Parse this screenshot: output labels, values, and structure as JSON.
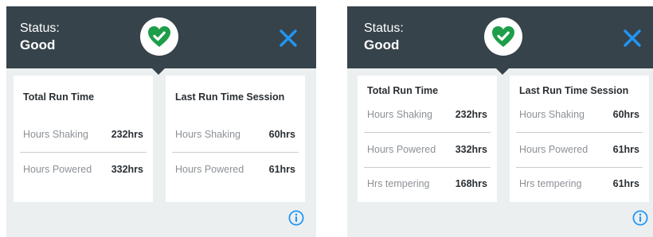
{
  "colors": {
    "header_bg": "#36434b",
    "accent_green": "#1e9e4a",
    "accent_blue": "#2196f3"
  },
  "panels": [
    {
      "status_label": "Status:",
      "status_value": "Good",
      "icons": {
        "status": "heart-check-icon",
        "close": "close-icon",
        "info": "info-icon"
      },
      "cards": [
        {
          "title": "Total Run Time",
          "rows": [
            {
              "label": "Hours Shaking",
              "value": "232hrs"
            },
            {
              "label": "Hours Powered",
              "value": "332hrs"
            }
          ]
        },
        {
          "title": "Last Run Time Session",
          "rows": [
            {
              "label": "Hours Shaking",
              "value": "60hrs"
            },
            {
              "label": "Hours Powered",
              "value": "61hrs"
            }
          ]
        }
      ]
    },
    {
      "status_label": "Status:",
      "status_value": "Good",
      "icons": {
        "status": "heart-check-icon",
        "close": "close-icon",
        "info": "info-icon"
      },
      "cards": [
        {
          "title": "Total Run Time",
          "rows": [
            {
              "label": "Hours Shaking",
              "value": "232hrs"
            },
            {
              "label": "Hours Powered",
              "value": "332hrs"
            },
            {
              "label": "Hrs tempering",
              "value": "168hrs"
            }
          ]
        },
        {
          "title": "Last Run Time Session",
          "rows": [
            {
              "label": "Hours Shaking",
              "value": "60hrs"
            },
            {
              "label": "Hours Powered",
              "value": "61hrs"
            },
            {
              "label": "Hrs tempering",
              "value": "61hrs"
            }
          ]
        }
      ]
    }
  ]
}
